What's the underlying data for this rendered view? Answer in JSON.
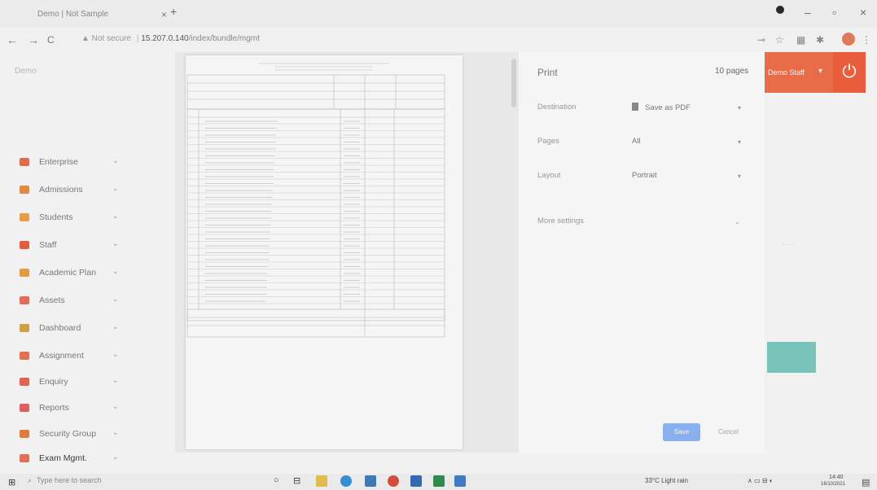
{
  "browser": {
    "tab_title": "Demo | Not Sample",
    "tab_close": "×",
    "new_tab": "+",
    "back": "←",
    "forward": "→",
    "reload": "C",
    "security": "▲ Not secure",
    "url_host": "15.207.0.140",
    "url_path": "/index/bundle/mgmt",
    "min": "–",
    "restore": "▫",
    "close": "×"
  },
  "sidebar": {
    "brand": "Demo",
    "items": [
      {
        "label": "Enterprise",
        "color": "#e86a4a"
      },
      {
        "label": "Admissions",
        "color": "#e88a3a"
      },
      {
        "label": "Students",
        "color": "#f0a040"
      },
      {
        "label": "Staff",
        "color": "#e85a3a"
      },
      {
        "label": "Academic Plan",
        "color": "#e8a03a"
      },
      {
        "label": "Assets",
        "color": "#e86a5a"
      },
      {
        "label": "Dashboard",
        "color": "#d8a040"
      },
      {
        "label": "Assignment",
        "color": "#e8704a"
      },
      {
        "label": "Enquiry",
        "color": "#e86050"
      },
      {
        "label": "Reports",
        "color": "#e85a5a"
      },
      {
        "label": "Security Group",
        "color": "#e87a3a"
      },
      {
        "label": "Exam Mgmt.",
        "color": "#e87050"
      }
    ],
    "chevron": "⌄"
  },
  "print": {
    "title": "Print",
    "pages_count": "10 pages",
    "rows": [
      {
        "label": "Destination",
        "value": "Save as PDF"
      },
      {
        "label": "Pages",
        "value": "All"
      },
      {
        "label": "Layout",
        "value": "Portrait"
      },
      {
        "label": "More settings",
        "value": ""
      }
    ],
    "save": "Save",
    "cancel": "Cancel",
    "caret": "▾"
  },
  "app_right": {
    "staff_label": "Demo Staff",
    "power": "⏻"
  },
  "taskbar": {
    "start": "⊞",
    "search_placeholder": "Type here to search",
    "weather": "33°C  Light rain",
    "time": "14:40",
    "date": "16/10/2021",
    "tray": "∧  ▭ ⊟ ◐"
  }
}
